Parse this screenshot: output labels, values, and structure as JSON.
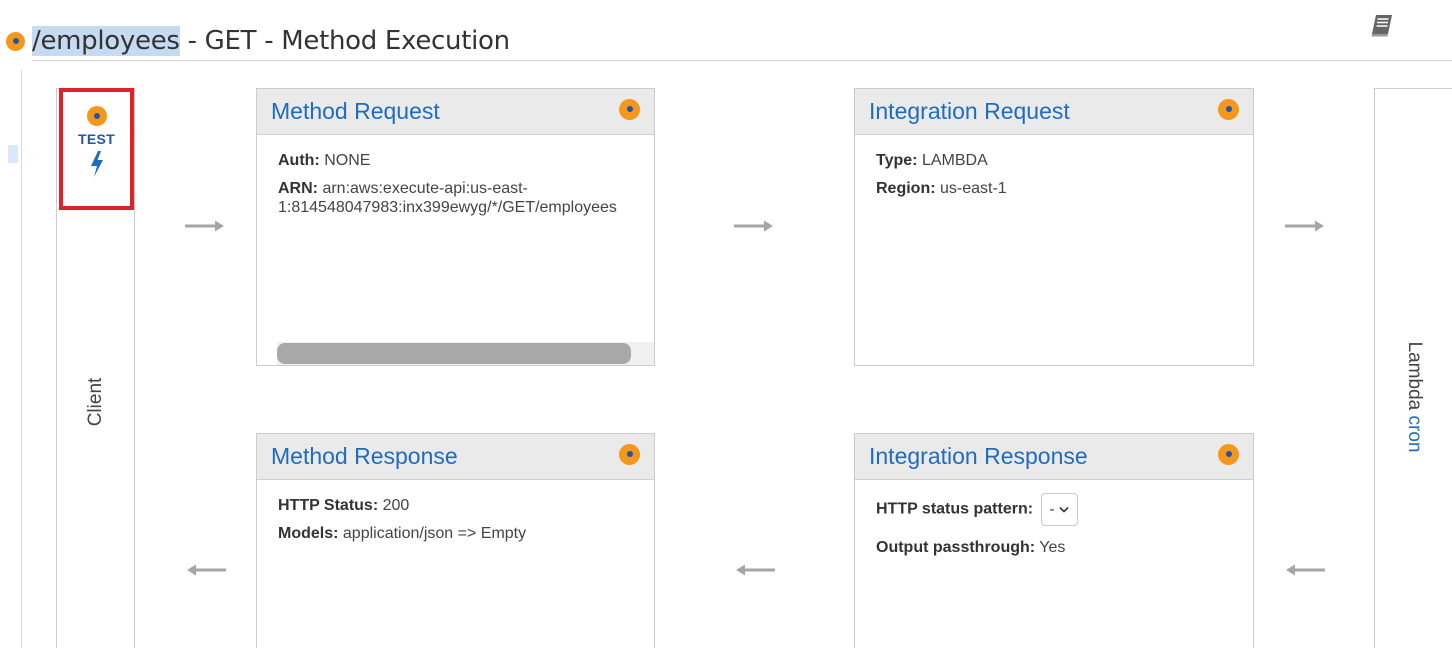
{
  "header": {
    "resource_path": "/employees",
    "title_rest": " - GET - Method Execution"
  },
  "client": {
    "test_label": "TEST",
    "label": "Client"
  },
  "method_request": {
    "title": "Method Request",
    "auth_label": "Auth:",
    "auth_value": "NONE",
    "arn_label": "ARN:",
    "arn_value": "arn:aws:execute-api:us-east-1:814548047983:inx399ewyg/*/GET/employees"
  },
  "integration_request": {
    "title": "Integration Request",
    "type_label": "Type:",
    "type_value": "LAMBDA",
    "region_label": "Region:",
    "region_value": "us-east-1"
  },
  "method_response": {
    "title": "Method Response",
    "status_label": "HTTP Status:",
    "status_value": "200",
    "models_label": "Models:",
    "models_value": "application/json => Empty"
  },
  "integration_response": {
    "title": "Integration Response",
    "pattern_label": "HTTP status pattern:",
    "pattern_value": "-",
    "passthrough_label": "Output passthrough:",
    "passthrough_value": "Yes"
  },
  "lambda": {
    "label": "Lambda",
    "function_name": "cron"
  },
  "colors": {
    "accent_orange": "#f5961d",
    "link_blue": "#1f6cbf",
    "highlight_red": "#e0202a"
  },
  "icons": {
    "help": "book-icon",
    "test": "bolt-icon",
    "arrow_right": "arrow-right-icon",
    "arrow_left": "arrow-left-icon"
  }
}
